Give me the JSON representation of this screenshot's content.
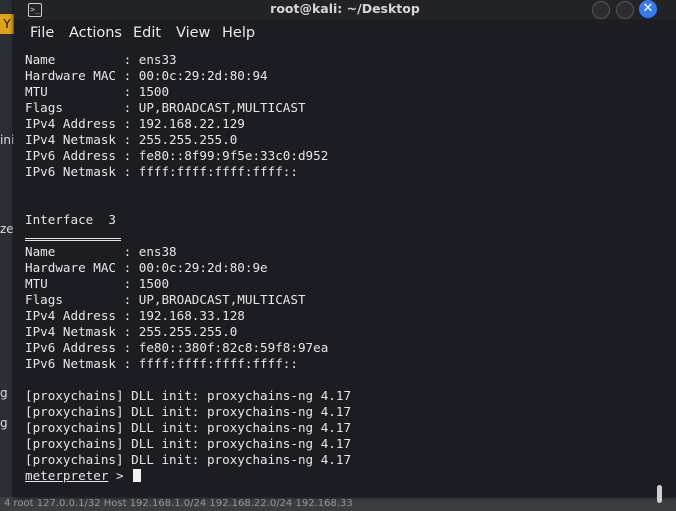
{
  "window": {
    "title": "root@kali: ~/Desktop"
  },
  "menubar": [
    "File",
    "Actions",
    "Edit",
    "View",
    "Help"
  ],
  "terminal": {
    "lines": [
      "Name         : ens33",
      "Hardware MAC : 00:0c:29:2d:80:94",
      "MTU          : 1500",
      "Flags        : UP,BROADCAST,MULTICAST",
      "IPv4 Address : 192.168.22.129",
      "IPv4 Netmask : 255.255.255.0",
      "IPv6 Address : fe80::8f99:9f5e:33c0:d952",
      "IPv6 Netmask : ffff:ffff:ffff:ffff::",
      "",
      "",
      "Interface  3",
      "============",
      "Name         : ens38",
      "Hardware MAC : 00:0c:29:2d:80:9e",
      "MTU          : 1500",
      "Flags        : UP,BROADCAST,MULTICAST",
      "IPv4 Address : 192.168.33.128",
      "IPv4 Netmask : 255.255.255.0",
      "IPv6 Address : fe80::380f:82c8:59f8:97ea",
      "IPv6 Netmask : ffff:ffff:ffff:ffff::",
      "",
      "[proxychains] DLL init: proxychains-ng 4.17",
      "[proxychains] DLL init: proxychains-ng 4.17",
      "[proxychains] DLL init: proxychains-ng 4.17",
      "[proxychains] DLL init: proxychains-ng 4.17",
      "[proxychains] DLL init: proxychains-ng 4.17"
    ],
    "prompt": "meterpreter",
    "prompt_suffix": " > "
  },
  "background": {
    "badge": "Y",
    "side_texts": [
      "ini",
      "ze",
      "g",
      "g"
    ],
    "bottom_text": "4 root   127.0.0.1/32 Host 192.168.1.0/24 192.168.22.0/24 192.168.33"
  }
}
